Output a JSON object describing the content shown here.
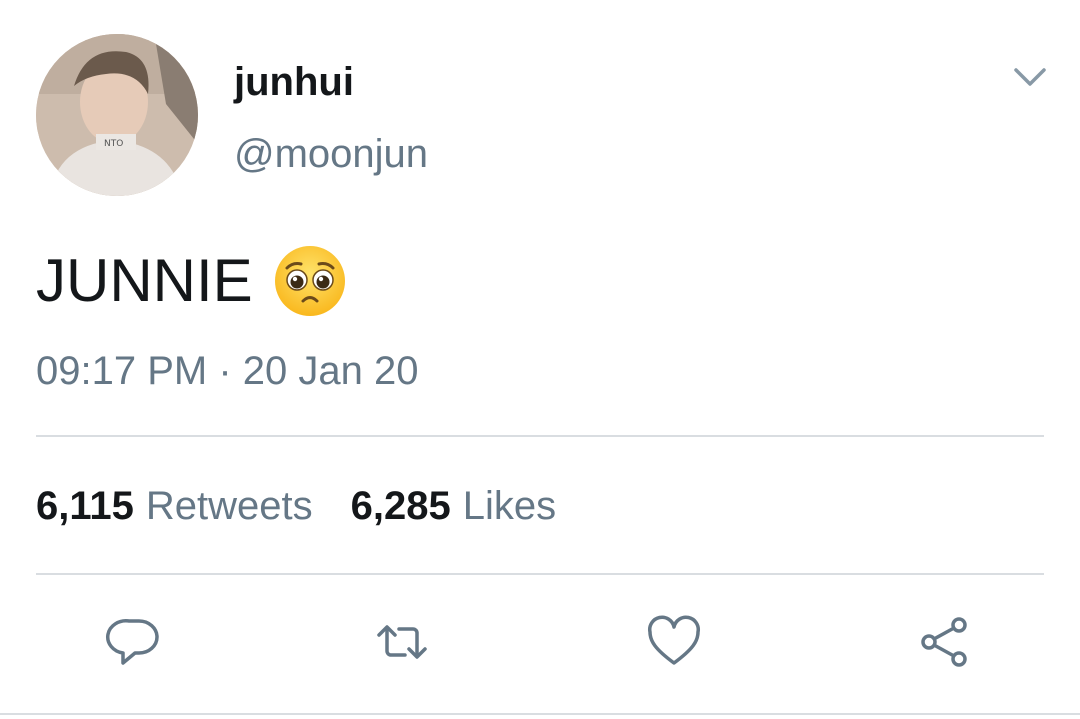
{
  "user": {
    "display_name": "junhui",
    "handle": "@moonjun",
    "avatar_icon": "profile-photo"
  },
  "tweet": {
    "text": "JUNNIE",
    "emoji": "pleading-face",
    "timestamp": "09:17 PM · 20 Jan 20"
  },
  "stats": {
    "retweets_count": "6,115",
    "retweets_label": "Retweets",
    "likes_count": "6,285",
    "likes_label": "Likes"
  },
  "actions": {
    "icons": [
      "reply-icon",
      "retweet-icon",
      "like-icon",
      "share-icon"
    ]
  },
  "colors": {
    "primary_text": "#14171a",
    "secondary_text": "#657786",
    "divider": "#d9dde1",
    "icon": "#657786"
  }
}
